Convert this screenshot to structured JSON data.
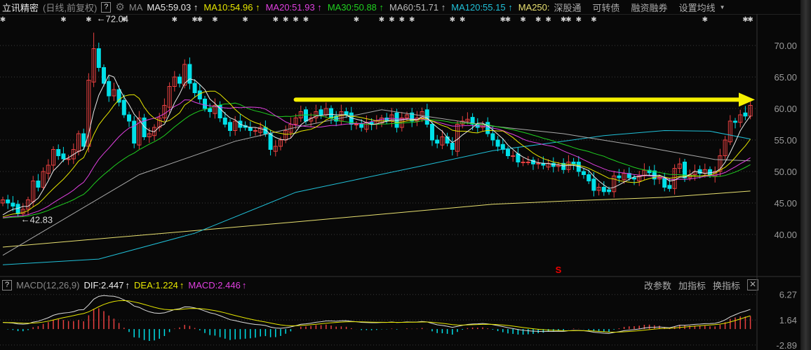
{
  "header": {
    "stock_name": "立讯精密",
    "period": "(日线,前复权)",
    "help": "?",
    "ma_label": "MA",
    "ma": [
      {
        "label": "MA5:59.03",
        "color": "#e8e8e8"
      },
      {
        "label": "MA10:54.96",
        "color": "#e6e600"
      },
      {
        "label": "MA20:51.93",
        "color": "#e040e0"
      },
      {
        "label": "MA30:50.88",
        "color": "#20d020"
      },
      {
        "label": "MA60:51.71",
        "color": "#bbbbbb"
      },
      {
        "label": "MA120:55.15",
        "color": "#20c0d8"
      },
      {
        "label": "MA250:",
        "color": "#e8e070"
      }
    ],
    "arrow": "↑",
    "menu": [
      "深股通",
      "可转债",
      "融资融券",
      "设置均线"
    ]
  },
  "macd_header": {
    "help": "?",
    "name": "MACD(12,26,9)",
    "dif": "DIF:2.447",
    "dea": "DEA:1.224",
    "macd": "MACD:2.446",
    "arrow": "↑",
    "tools": [
      "改参数",
      "加指标",
      "换指标"
    ],
    "close": "✕"
  },
  "colors": {
    "up": "#e84040",
    "down": "#00e0e8",
    "bg": "#080808",
    "arrow": "#f5f000"
  },
  "chart_data": {
    "type": "candlestick",
    "price_axis": {
      "ticks": [
        "70.00",
        "65.00",
        "60.00",
        "55.00",
        "50.00",
        "45.00",
        "40.00"
      ],
      "range": [
        36.1,
        76.6
      ]
    },
    "macd_axis": {
      "ticks": [
        "6.27",
        "1.64",
        "-2.89"
      ],
      "range": [
        -3.8,
        7.0
      ]
    },
    "closes": [
      45.5,
      45,
      44.5,
      43.3,
      44,
      45.5,
      48.5,
      47.5,
      50,
      51,
      53.5,
      52.5,
      52,
      52,
      53.5,
      56,
      54,
      64.5,
      69.5,
      66.5,
      64,
      62,
      63,
      61,
      59,
      58,
      54.5,
      58.5,
      55.5,
      56,
      57,
      58.5,
      60.5,
      63.5,
      65,
      64,
      67,
      64,
      62.5,
      61.5,
      60,
      59.5,
      60.5,
      58.5,
      57.5,
      56.5,
      58,
      57,
      57,
      56.5,
      56.5,
      57,
      56,
      53.5,
      54,
      55,
      56.5,
      57.5,
      58.5,
      59.5,
      58,
      58.5,
      59.5,
      59,
      60,
      58.5,
      58,
      59.5,
      59,
      57.5,
      57.5,
      57,
      57.8,
      57.5,
      58,
      58.5,
      58,
      59,
      57,
      58.5,
      59,
      58,
      58.5,
      59.5,
      57.5,
      55,
      54.5,
      55.5,
      54.5,
      53.5,
      57.5,
      58,
      58.3,
      57.5,
      57,
      57.5,
      56,
      55,
      54,
      53.5,
      52.5,
      52.5,
      51.5,
      51.5,
      51.5,
      51.2,
      51.3,
      51,
      51.3,
      50.8,
      51,
      50.3,
      51.5,
      51.2,
      50,
      49.5,
      48.5,
      47,
      47.5,
      46.8,
      46.8,
      49.3,
      49,
      49.7,
      49,
      48.8,
      49.3,
      50.2,
      49.8,
      48.8,
      49,
      47.5,
      47.3,
      50.5,
      51.2,
      49,
      49.5,
      50,
      49.7,
      50.3,
      49.5,
      50,
      52.5,
      55,
      58,
      57.8,
      59,
      58.8,
      60.5
    ],
    "high_label": {
      "index": 18,
      "value": "72.04"
    },
    "low_label": {
      "index": 3,
      "value": "42.83"
    },
    "ma60": [
      [
        0,
        36.7
      ],
      [
        27,
        49.5
      ],
      [
        46,
        54.8
      ],
      [
        58,
        57
      ],
      [
        75,
        59.8
      ],
      [
        97,
        57.2
      ],
      [
        111,
        56
      ],
      [
        125,
        54.2
      ],
      [
        141,
        51.9
      ],
      [
        148,
        51.7
      ]
    ],
    "ma120": [
      [
        0,
        35.2
      ],
      [
        19,
        36.1
      ],
      [
        38,
        40.2
      ],
      [
        58,
        46.7
      ],
      [
        83,
        50.9
      ],
      [
        97,
        53.3
      ],
      [
        111,
        54.8
      ],
      [
        119,
        55.7
      ],
      [
        131,
        56.5
      ],
      [
        140,
        56.4
      ],
      [
        148,
        55.15
      ]
    ],
    "ma250": [
      [
        0,
        38
      ],
      [
        58,
        42
      ],
      [
        97,
        44.8
      ],
      [
        111,
        45.3
      ],
      [
        131,
        45.9
      ],
      [
        148,
        46.9
      ]
    ],
    "markers": [
      0,
      12,
      17,
      24,
      34,
      38,
      39,
      42,
      48,
      54,
      56,
      58,
      60,
      70,
      75,
      77,
      79,
      81,
      89,
      91,
      99,
      100,
      103,
      106,
      108,
      111,
      112,
      114,
      117,
      139,
      147,
      148
    ],
    "marker_glyph": "✱",
    "signal": {
      "index": 110,
      "label": "S"
    },
    "trend_arrow": {
      "from_index": 58,
      "level": 61.4
    }
  }
}
